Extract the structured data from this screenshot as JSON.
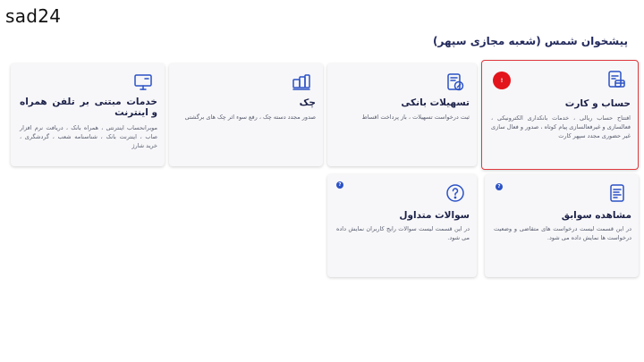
{
  "corner_label": "sad24",
  "page_title": "پیشخوان شمس (شعبه مجازی سپهر)",
  "colors": {
    "accent": "#2b52c6",
    "selected_border": "#e0393e",
    "badge": "#e3141b",
    "title": "#232a5c"
  },
  "cards": {
    "account": {
      "icon": "card-document-icon",
      "badge": "!",
      "title": "حساب و کارت",
      "desc": "افتتاح حساب ریالی ، خدمات بانکداری الکترونیکی ، فعالسازی و غیرفعالسازی پیام کوتاه ، صدور و فعال سازی غیر حضوری مجدد سپهر کارت"
    },
    "loans": {
      "icon": "loan-document-icon",
      "title": "تسهیلات بانکی",
      "desc": "ثبت درخواست تسهیلات ، باز پرداخت اقساط"
    },
    "cheque": {
      "icon": "cheque-icon",
      "title": "چک",
      "desc": "صدور مجدد دسته چک ، رفع سوء اثر چک های برگشتی"
    },
    "mobile": {
      "icon": "computer-icon",
      "title": "خدمات مبتنی بر تلفن همراه و اینترنت",
      "desc": "موبرانحساب اینترنتی ، همراه بانک ، دریافت نرم افزار صاب ، اینترنت بانک ، شناسنامه شعب ، گردشگری ، خرید شارژ"
    },
    "history": {
      "icon": "history-document-icon",
      "title": "مشاهده سوابق",
      "desc": "در این قسمت لیست درخواست های متقاضی و وضعیت درخواست ها نمایش داده می شود."
    },
    "faq": {
      "icon": "question-circle-icon",
      "title": "سوالات متداول",
      "desc": "در این قسمت لیست سوالات رایج کاربران نمایش داده می شود."
    }
  }
}
